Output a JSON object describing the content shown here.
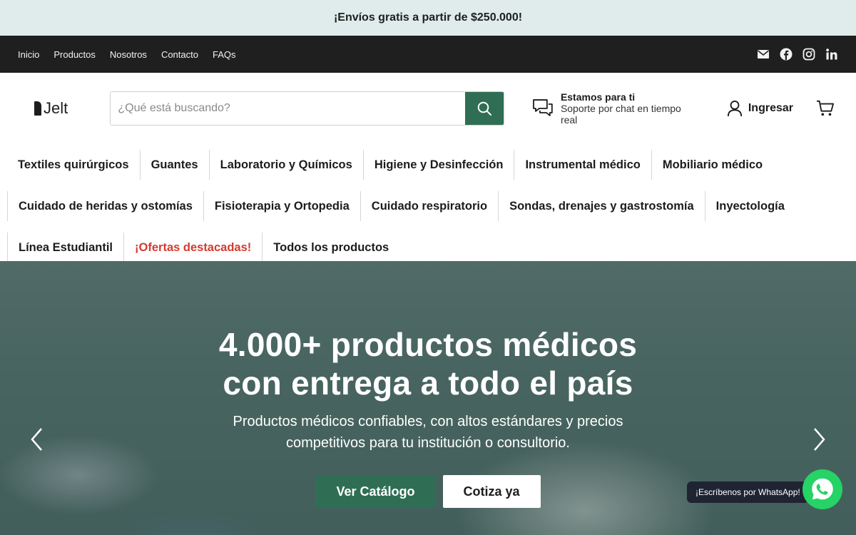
{
  "announcement": "¡Envíos gratis a partir de $250.000!",
  "top_nav": {
    "links": [
      "Inicio",
      "Productos",
      "Nosotros",
      "Contacto",
      "FAQs"
    ],
    "social_icons": [
      "mail-icon",
      "facebook-icon",
      "instagram-icon",
      "linkedin-icon"
    ]
  },
  "header": {
    "logo_text": "Jelt",
    "search_placeholder": "¿Qué está buscando?",
    "support_title": "Estamos para ti",
    "support_subtitle": "Soporte por chat en tiempo real",
    "login_label": "Ingresar"
  },
  "categories": {
    "row1": [
      "Textiles quirúrgicos",
      "Guantes",
      "Laboratorio y Químicos",
      "Higiene y Desinfección",
      "Instrumental médico",
      "Mobiliario médico"
    ],
    "row2": [
      "Cuidado de heridas y ostomías",
      "Fisioterapia y Ortopedia",
      "Cuidado respiratorio",
      "Sondas, drenajes y gastrostomía",
      "Inyectología"
    ],
    "row3": [
      "Línea Estudiantil",
      "¡Ofertas destacadas!",
      "Todos los productos"
    ]
  },
  "hero": {
    "title": "4.000+ productos médicos con entrega a todo el país",
    "subtitle": "Productos médicos confiables, con altos estándares y precios competitivos para tu institución o consultorio.",
    "primary_cta": "Ver Catálogo",
    "secondary_cta": "Cotiza ya"
  },
  "whatsapp": {
    "tooltip": "¡Escríbenos por WhatsApp!"
  },
  "colors": {
    "brand_green": "#2f6e55",
    "offer_red": "#d43a2f",
    "announcement_bg": "#dfeceb",
    "topnav_bg": "#1f1f1f",
    "whatsapp_green": "#25d366"
  }
}
